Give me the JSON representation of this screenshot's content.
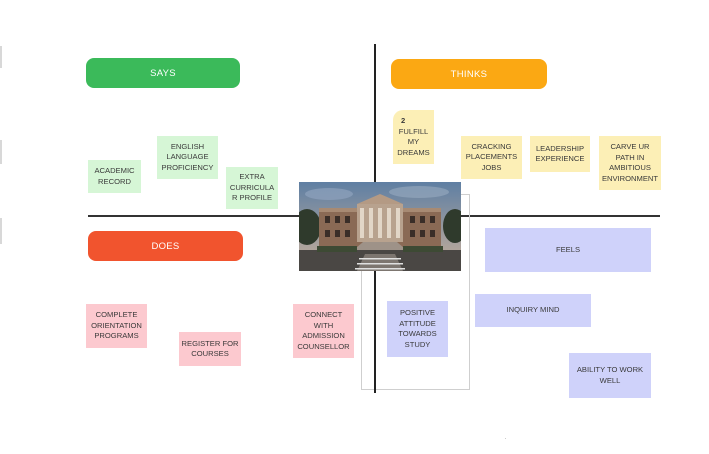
{
  "quadrants": {
    "says": {
      "label": "SAYS",
      "color": "#3bba5a"
    },
    "thinks": {
      "label": "THINKS",
      "color": "#fba813"
    },
    "does": {
      "label": "DOES",
      "color": "#f1542e"
    }
  },
  "says_notes": [
    {
      "text": "ACADEMIC RECORD"
    },
    {
      "text": "ENGLISH LANGUAGE PROFICIENCY"
    },
    {
      "text": "EXTRA CURRICULA R PROFILE"
    }
  ],
  "thinks_notes": [
    {
      "badge": "2",
      "text": "FULFILL MY DREAMS"
    },
    {
      "text": "CRACKING PLACEMENTS JOBS"
    },
    {
      "text": "LEADERSHIP EXPERIENCE"
    },
    {
      "text": "CARVE UR PATH IN AMBITIOUS ENVIRONMENT"
    }
  ],
  "does_notes": [
    {
      "text": "COMPLETE ORIENTATION PROGRAMS"
    },
    {
      "text": "REGISTER FOR COURSES"
    },
    {
      "text": "CONNECT WITH ADMISSION COUNSELLOR"
    }
  ],
  "feels_notes": [
    {
      "text": "FEELS"
    },
    {
      "text": "INQUIRY MIND"
    },
    {
      "text": "POSITIVE ATTITUDE TOWARDS STUDY"
    },
    {
      "text": "ABILITY TO WORK WELL"
    }
  ],
  "colors": {
    "says_note": "#d6f6d6",
    "thinks_note": "#fcefb6",
    "does_note": "#fcc9cf",
    "feels_note": "#cfd2fa"
  }
}
